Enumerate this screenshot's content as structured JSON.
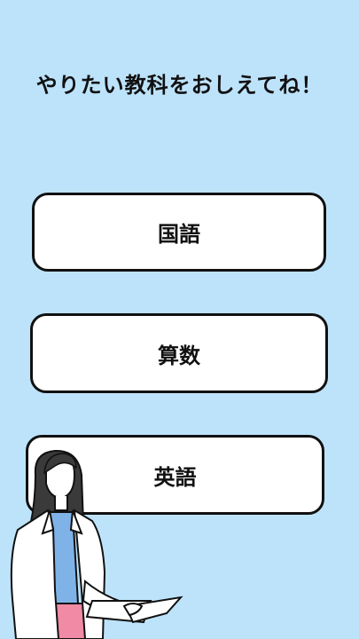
{
  "screen": {
    "background": "#bde3fb"
  },
  "title": "やりたい教科をおしえてね！",
  "subjects": [
    {
      "label": "国語"
    },
    {
      "label": "算数"
    },
    {
      "label": "英語"
    }
  ],
  "illustration": {
    "icon": "teacher-holding-papers-illustration"
  }
}
